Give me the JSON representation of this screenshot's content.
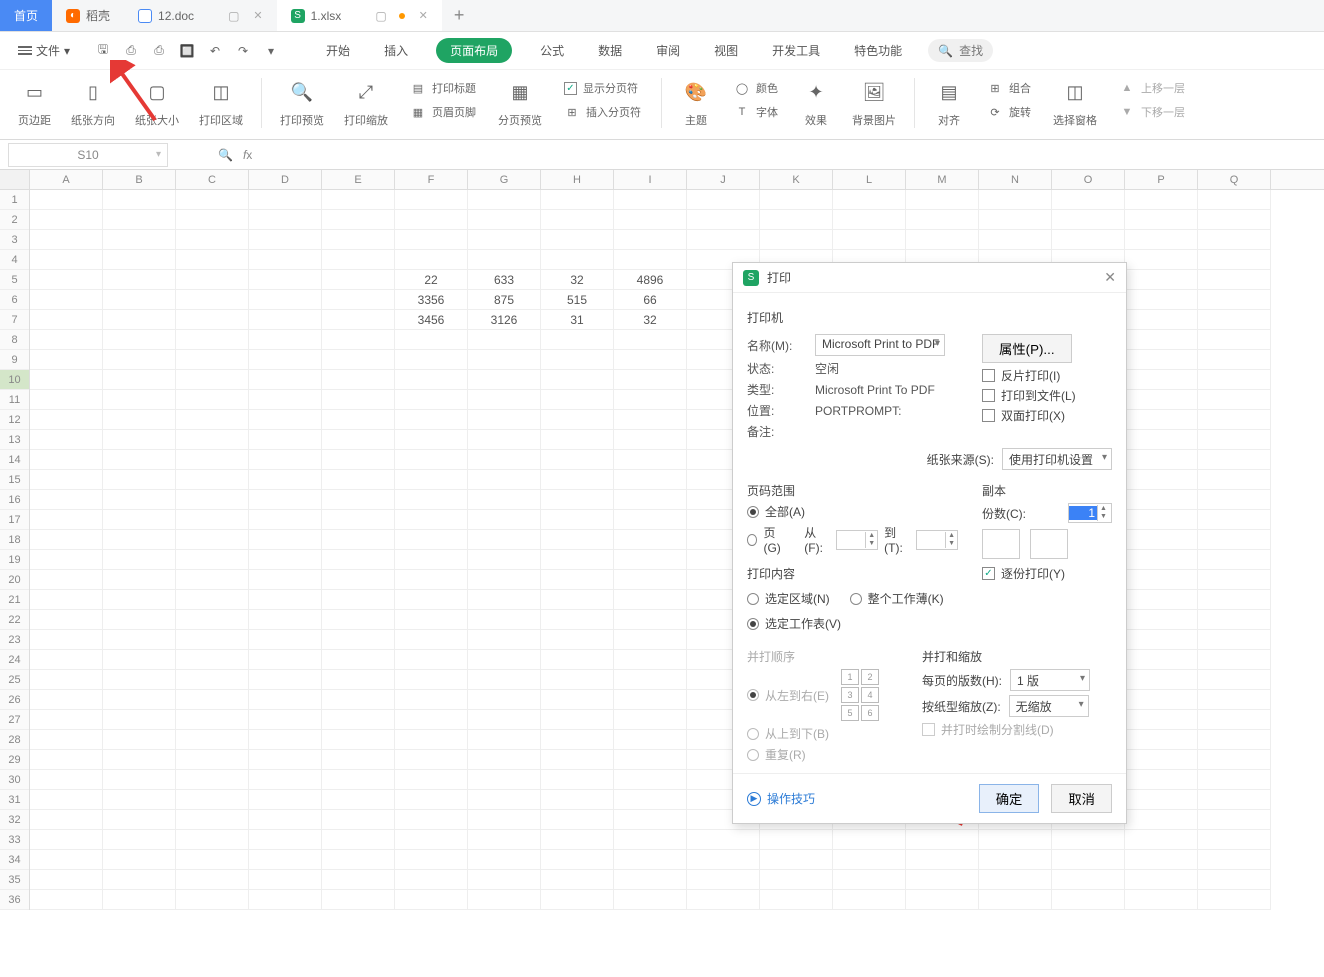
{
  "tabs": {
    "home": "首页",
    "daoke": "稻壳",
    "doc": "12.doc",
    "xlsx": "1.xlsx"
  },
  "file_menu": "文件",
  "ribbon_menus": {
    "start": "开始",
    "insert": "插入",
    "page_layout": "页面布局",
    "formula": "公式",
    "data": "数据",
    "review": "审阅",
    "view": "视图",
    "dev": "开发工具",
    "special": "特色功能",
    "search": "查找"
  },
  "ribbon": {
    "margin": "页边距",
    "orient": "纸张方向",
    "size": "纸张大小",
    "area": "打印区域",
    "preview": "打印预览",
    "scale": "打印缩放",
    "title": "打印标题",
    "header": "页眉页脚",
    "page_preview": "分页预览",
    "show_break": "显示分页符",
    "insert_break": "插入分页符",
    "theme": "主题",
    "color": "颜色",
    "font": "字体",
    "effect": "效果",
    "bgimg": "背景图片",
    "align": "对齐",
    "group": "组合",
    "rotate": "旋转",
    "pane": "选择窗格",
    "up_layer": "上移一层",
    "down_layer": "下移一层"
  },
  "namebox": "S10",
  "columns": [
    "A",
    "B",
    "C",
    "D",
    "E",
    "F",
    "G",
    "H",
    "I",
    "J",
    "K",
    "L",
    "M",
    "N",
    "O",
    "P",
    "Q"
  ],
  "data_rows": [
    {
      "r": 5,
      "F": "22",
      "G": "633",
      "H": "32",
      "I": "4896"
    },
    {
      "r": 6,
      "F": "3356",
      "G": "875",
      "H": "515",
      "I": "66"
    },
    {
      "r": 7,
      "F": "3456",
      "G": "3126",
      "H": "31",
      "I": "32"
    }
  ],
  "print_dialog": {
    "title": "打印",
    "printer_section": "打印机",
    "name_lbl": "名称(M):",
    "name_val": "Microsoft Print to PDF",
    "properties": "属性(P)...",
    "status_lbl": "状态:",
    "status_val": "空闲",
    "type_lbl": "类型:",
    "type_val": "Microsoft Print To PDF",
    "loc_lbl": "位置:",
    "loc_val": "PORTPROMPT:",
    "remark_lbl": "备注:",
    "reverse": "反片打印(I)",
    "to_file": "打印到文件(L)",
    "duplex": "双面打印(X)",
    "source_lbl": "纸张来源(S):",
    "source_val": "使用打印机设置",
    "range_section": "页码范围",
    "range_all": "全部(A)",
    "range_page": "页(G)",
    "from_lbl": "从(F):",
    "to_lbl": "到(T):",
    "copies_section": "副本",
    "copies_lbl": "份数(C):",
    "copies_val": "1",
    "collate": "逐份打印(Y)",
    "content_section": "打印内容",
    "sel_area": "选定区域(N)",
    "whole_book": "整个工作薄(K)",
    "sel_sheet": "选定工作表(V)",
    "order_section": "并打顺序",
    "order_lr": "从左到右(E)",
    "order_tb": "从上到下(B)",
    "order_repeat": "重复(R)",
    "scale_section": "并打和缩放",
    "per_page_lbl": "每页的版数(H):",
    "per_page_val": "1 版",
    "by_paper_lbl": "按纸型缩放(Z):",
    "by_paper_val": "无缩放",
    "draw_split": "并打时绘制分割线(D)",
    "tips": "操作技巧",
    "ok": "确定",
    "cancel": "取消"
  }
}
